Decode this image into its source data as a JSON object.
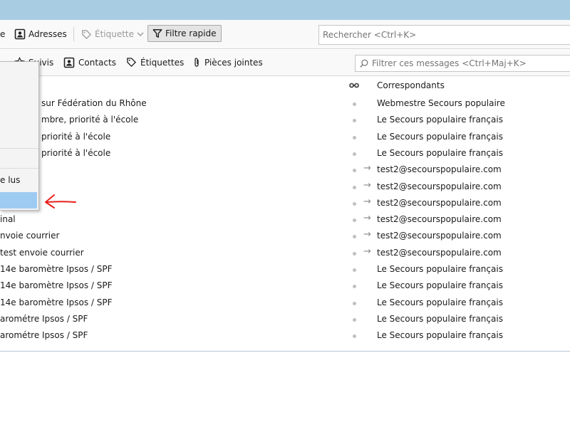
{
  "toolbar": {
    "partial_label": "e",
    "addresses_label": "Adresses",
    "tag_label": "Étiquette",
    "quick_filter_label": "Filtre rapide",
    "search_placeholder": "Rechercher <Ctrl+K>"
  },
  "quick_filter_bar": {
    "followed_label": "Suivis",
    "contacts_label": "Contacts",
    "tags_label": "Étiquettes",
    "attachments_label": "Pièces jointes",
    "filter_placeholder": "Filtrer ces messages <Ctrl+Maj+K>"
  },
  "message_list": {
    "correspondents_header": "Correspondants",
    "rows": [
      {
        "subject": "sur Fédération du Rhône",
        "correspondent": "Webmestre Secours populaire",
        "arrow": false
      },
      {
        "subject": "mbre, priorité à l'école",
        "correspondent": "Le Secours populaire français",
        "arrow": false
      },
      {
        "subject": "priorité à l'école",
        "correspondent": "Le Secours populaire français",
        "arrow": false
      },
      {
        "subject": "priorité à l'école",
        "correspondent": "Le Secours populaire français",
        "arrow": false
      },
      {
        "subject": "",
        "correspondent": "test2@secourspopulaire.com",
        "arrow": true
      },
      {
        "subject": "",
        "correspondent": "test2@secourspopulaire.com",
        "arrow": true
      },
      {
        "subject": "",
        "correspondent": "test2@secourspopulaire.com",
        "arrow": true
      },
      {
        "subject": "inal",
        "correspondent": "test2@secourspopulaire.com",
        "arrow": true
      },
      {
        "subject": "nvoie courrier",
        "correspondent": "test2@secourspopulaire.com",
        "arrow": true
      },
      {
        "subject": "test envoie courrier",
        "correspondent": "test2@secourspopulaire.com",
        "arrow": true
      },
      {
        "subject": " 14e baromètre Ipsos / SPF",
        "correspondent": "Le Secours populaire français",
        "arrow": false
      },
      {
        "subject": " 14e baromètre Ipsos / SPF",
        "correspondent": "Le Secours populaire français",
        "arrow": false
      },
      {
        "subject": " 14e baromètre Ipsos / SPF",
        "correspondent": "Le Secours populaire français",
        "arrow": false
      },
      {
        "subject": "arométre Ipsos / SPF",
        "correspondent": "Le Secours populaire français",
        "arrow": false
      },
      {
        "subject": "arométre Ipsos / SPF",
        "correspondent": "Le Secours populaire français",
        "arrow": false
      }
    ]
  },
  "dropdown_menu": {
    "partial_item_label": "e lus"
  },
  "colors": {
    "titlebar": "#a8cde3",
    "menu_highlight": "#9ecbf2",
    "annotation_arrow": "#e8201c"
  }
}
